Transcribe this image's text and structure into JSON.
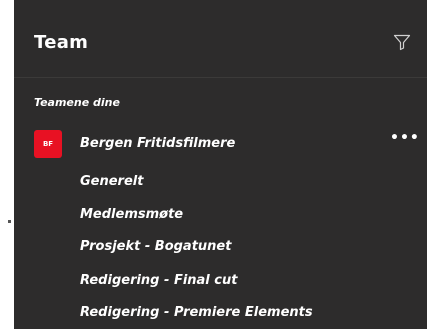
{
  "header": {
    "title": "Team",
    "filter_icon": "filter-icon"
  },
  "section": {
    "label": "Teamene dine"
  },
  "team": {
    "avatar_initials": "BF",
    "avatar_color": "#e81123",
    "name": "Bergen Fritidsfilmere",
    "more_label": "•••"
  },
  "channels": [
    {
      "label": "Generelt"
    },
    {
      "label": "Medlemsmøte"
    },
    {
      "label": "Prosjekt - Bogatunet"
    },
    {
      "label": "Redigering - Final cut"
    },
    {
      "label": "Redigering - Premiere Elements"
    }
  ]
}
